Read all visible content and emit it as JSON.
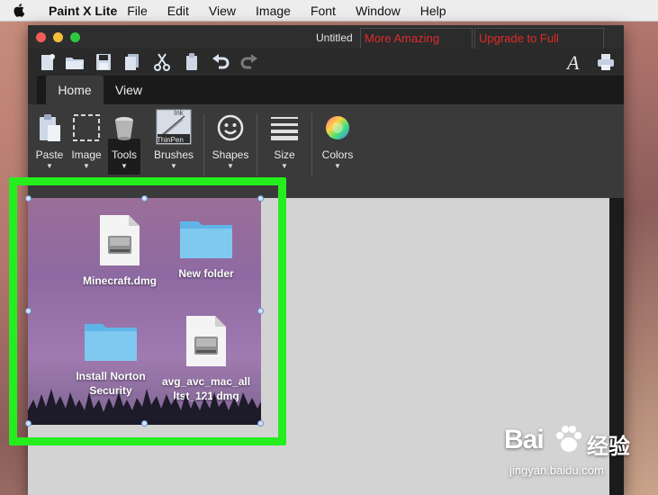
{
  "menubar": {
    "app_name": "Paint X Lite",
    "items": [
      "File",
      "Edit",
      "View",
      "Image",
      "Font",
      "Window",
      "Help"
    ]
  },
  "window": {
    "title": "Untitled",
    "promo_apps": "More Amazing Apps",
    "promo_upgrade": "Upgrade to Full Version"
  },
  "quickbar": {
    "icons": [
      "new-document-icon",
      "open-folder-icon",
      "save-icon",
      "copy-icon",
      "cut-icon",
      "paste-icon",
      "undo-icon",
      "redo-icon",
      "text-font-icon",
      "print-icon"
    ]
  },
  "tabs": [
    "Home",
    "View"
  ],
  "ribbon": {
    "paste": "Paste",
    "image": "Image",
    "tools": "Tools",
    "brushes": "Brushes",
    "brush_badge_top": "Ink",
    "brush_badge": "ThinPen",
    "shapes": "Shapes",
    "size": "Size",
    "colors": "Colors"
  },
  "canvas_files": [
    {
      "name": "Minecraft.dmg",
      "type": "dmg"
    },
    {
      "name": "New folder",
      "type": "folder"
    },
    {
      "name_line1": "Install Norton",
      "name_line2": "Security",
      "type": "folder"
    },
    {
      "name_line1": "avg_avc_mac_all",
      "name_line2": "ltst_121.dmg",
      "type": "dmg"
    }
  ],
  "colors": {
    "highlight": "#25ee1e",
    "promo_text": "#e02a2a",
    "canvas_bg": "#d3d3d3"
  },
  "watermark": {
    "logo": "Bai",
    "logo_cn": "经验",
    "url": "jingyan.baidu.com"
  }
}
